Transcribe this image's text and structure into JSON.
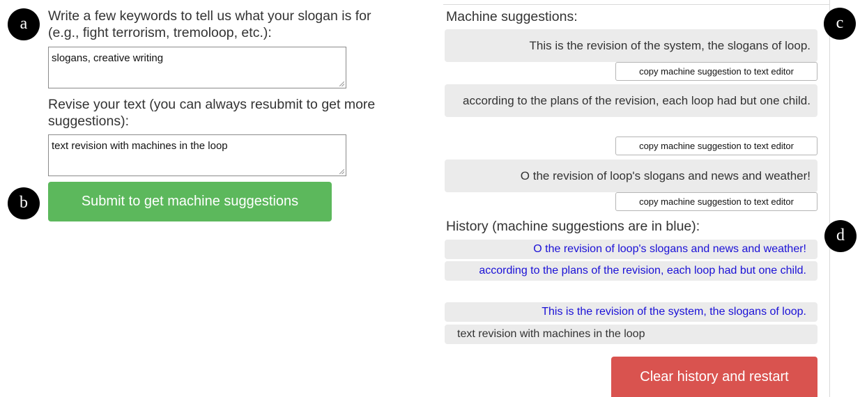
{
  "markers": {
    "a": "a",
    "b": "b",
    "c": "c",
    "d": "d"
  },
  "left": {
    "keywords_label": "Write a few keywords to tell us what your slogan is for (e.g., fight terrorism, tremoloop, etc.):",
    "keywords_value": "slogans, creative writing",
    "revise_label": "Revise your text (you can always resubmit to get more suggestions):",
    "revise_value": "text revision with machines in the loop",
    "submit_label": "Submit to get machine suggestions"
  },
  "right": {
    "suggestions_heading": "Machine suggestions:",
    "suggestions": [
      {
        "text": "This is the revision of the system, the slogans of loop.",
        "copy_label": "copy machine suggestion to text editor"
      },
      {
        "text": "according to the plans of the revision, each loop had but one child.",
        "copy_label": "copy machine suggestion to text editor"
      },
      {
        "text": "O the revision of loop's slogans and news and weather!",
        "copy_label": "copy machine suggestion to text editor"
      }
    ],
    "history_heading": "History (machine suggestions are in blue):",
    "history": [
      {
        "text": "O the revision of loop's slogans and news and weather!",
        "source": "machine"
      },
      {
        "text": "according to the plans of the revision, each loop had but one child.",
        "source": "machine"
      },
      {
        "text": "This is the revision of the system, the slogans of loop.",
        "source": "machine"
      },
      {
        "text": "text revision with machines in the loop",
        "source": "user"
      }
    ],
    "clear_label": "Clear history and restart"
  },
  "colors": {
    "submit_green": "#5cb85c",
    "clear_red": "#d9534f",
    "machine_blue": "#1a10d6",
    "suggestion_gray": "#ebebeb"
  }
}
